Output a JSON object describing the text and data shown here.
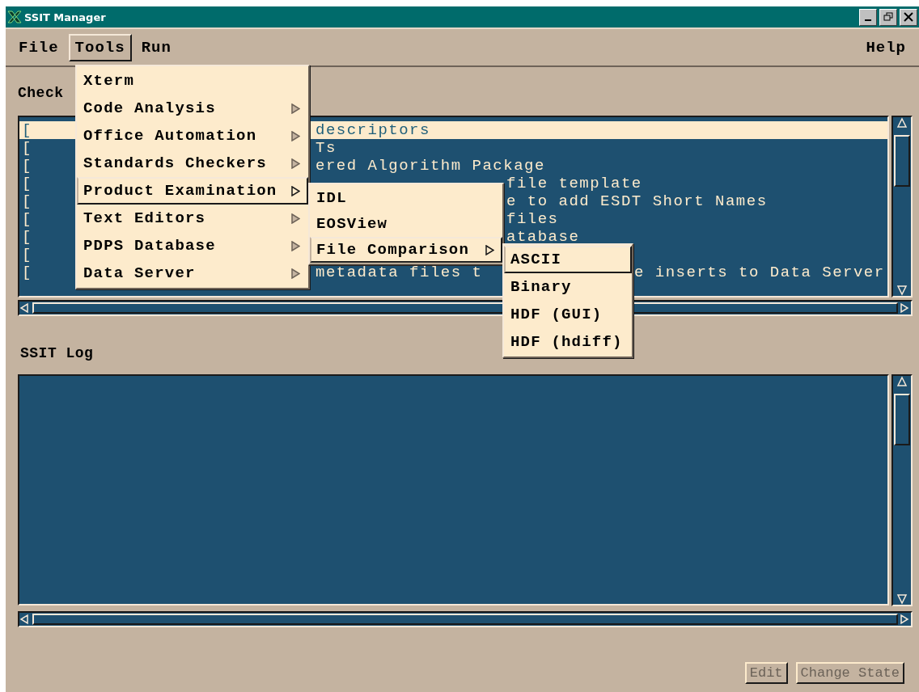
{
  "window": {
    "title": "SSIT Manager"
  },
  "menubar": [
    {
      "label": "File",
      "selected": false
    },
    {
      "label": "Tools",
      "selected": true
    },
    {
      "label": "Run",
      "selected": false
    }
  ],
  "help_menu": {
    "label": "Help"
  },
  "tools_menu": [
    {
      "label": "Xterm",
      "kind": "command",
      "selected": false
    },
    {
      "label": "Code Analysis",
      "kind": "cascade",
      "selected": false
    },
    {
      "label": "Office Automation",
      "kind": "cascade",
      "selected": false
    },
    {
      "label": "Standards Checkers",
      "kind": "cascade",
      "selected": false
    },
    {
      "label": "Product Examination",
      "kind": "cascade",
      "selected": true
    },
    {
      "label": "Text Editors",
      "kind": "cascade",
      "selected": false
    },
    {
      "label": "PDPS Database",
      "kind": "cascade",
      "selected": false
    },
    {
      "label": "Data Server",
      "kind": "cascade",
      "selected": false
    }
  ],
  "product_examination_menu": [
    {
      "label": "IDL",
      "kind": "command",
      "selected": false
    },
    {
      "label": "EOSView",
      "kind": "command",
      "selected": false
    },
    {
      "label": "File Comparison",
      "kind": "cascade",
      "selected": true
    }
  ],
  "file_comparison_menu": [
    {
      "label": "ASCII",
      "selected": true
    },
    {
      "label": "Binary",
      "selected": false
    },
    {
      "label": "HDF (GUI)",
      "selected": false
    },
    {
      "label": "HDF (hdiff)",
      "selected": false
    }
  ],
  "checklist": {
    "label": "Check",
    "rows": [
      {
        "bracket": "[",
        "selected": true,
        "visible_left": "descriptors"
      },
      {
        "bracket": "[",
        "selected": false,
        "visible_left": "Ts"
      },
      {
        "bracket": "[",
        "selected": false,
        "visible_left": "ered Algorithm Package"
      },
      {
        "bracket": "[",
        "selected": false,
        "visible_middle": "file template"
      },
      {
        "bracket": "[",
        "selected": false,
        "visible_middle": "e to add ESDT Short Names"
      },
      {
        "bracket": "[",
        "selected": false,
        "visible_middle": "files"
      },
      {
        "bracket": "[",
        "selected": false,
        "visible_middle": "atabase"
      },
      {
        "bracket": "[",
        "selected": false
      },
      {
        "bracket": "[",
        "selected": false,
        "visible_left": "metadata files t",
        "visible_right": "e inserts to Data Server"
      }
    ]
  },
  "log": {
    "label": "SSIT Log"
  },
  "buttons": [
    {
      "label": "Edit",
      "disabled": true
    },
    {
      "label": "Change State",
      "disabled": true
    }
  ]
}
